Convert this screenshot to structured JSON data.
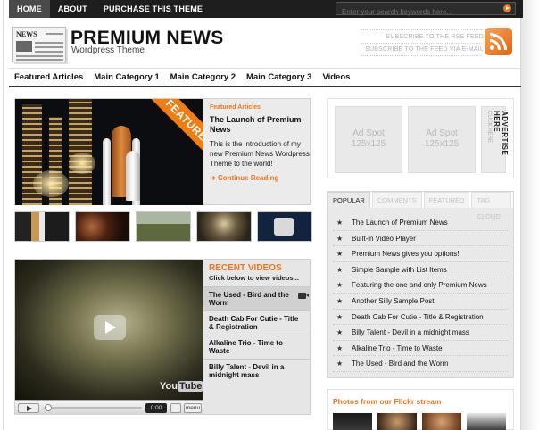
{
  "topnav": {
    "items": [
      "HOME",
      "ABOUT",
      "PURCHASE THIS THEME"
    ],
    "active_index": 0
  },
  "search": {
    "placeholder": "Enter your search keywords here..."
  },
  "header": {
    "logo_text": "NEWS",
    "title": "PREMIUM NEWS",
    "subtitle": "Wordpress Theme",
    "rss_link_1": "SUBSCRIBE TO THE RSS FEED",
    "rss_link_2": "SUBSCRIBE TO THE FEED VIA E-MAIL"
  },
  "categories": [
    "Featured Articles",
    "Main Category 1",
    "Main Category 2",
    "Main Category 3",
    "Videos"
  ],
  "featured": {
    "ribbon": "FEATURED",
    "label": "Featured Articles",
    "title": "The Launch of Premium News",
    "body": "This is the introduction of my new Premium News Wordpress Theme to the world!",
    "more": "Continue Reading"
  },
  "videos": {
    "title": "RECENT VIDEOS",
    "subtitle": "Click below to view videos...",
    "items": [
      "The Used - Bird and the Worm",
      "Death Cab For Cutie - Title & Registration",
      "Alkaline Trio - Time to Waste",
      "Billy Talent - Devil in a midnight mass"
    ],
    "active_index": 0,
    "player": {
      "time": "0:00",
      "menu": "menu",
      "brand": "You",
      "brand_box": "Tube"
    }
  },
  "ads": {
    "spot_1": "Ad Spot 125x125",
    "spot_2": "Ad Spot 125x125",
    "advertise": "ADVERTISE HERE",
    "advertise_sub": "CLICK HERE"
  },
  "tabs": {
    "labels": [
      "POPULAR",
      "COMMENTS",
      "FEATURED",
      "TAG CLOUD"
    ],
    "active_index": 0,
    "popular": [
      "The Launch of Premium News",
      "Built-in Video Player",
      "Premium News gives you options!",
      "Simple Sample with List Items",
      "Featuring the one and only Premium News",
      "Another Silly Sample Post",
      "Death Cab For Cutie - Title & Registration",
      "Billy Talent - Devil in a midnight mass",
      "Alkaline Trio - Time to Waste",
      "The Used - Bird and the Worm"
    ]
  },
  "flickr": {
    "title": "Photos from our Flickr stream"
  },
  "colors": {
    "accent": "#e8761e",
    "topbar": "#1e1e1e",
    "panel": "#ebebeb"
  },
  "icons": {
    "rss": "rss-icon",
    "search_go": "arrow-right-icon",
    "star": "star-icon",
    "play": "play-icon",
    "camera": "video-camera-icon",
    "volume": "volume-icon"
  }
}
